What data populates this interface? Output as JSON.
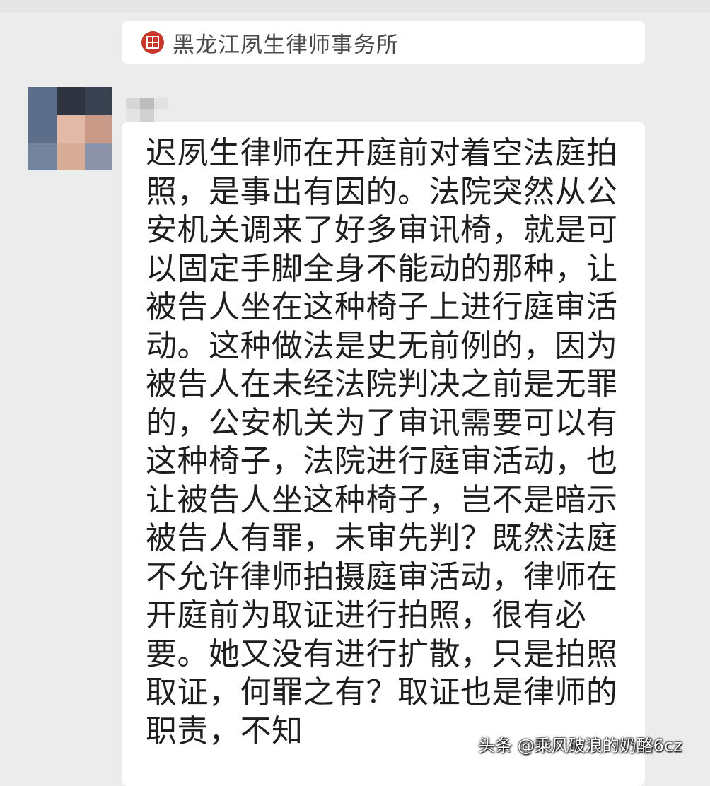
{
  "firm_card": {
    "name": "黑龙江夙生律师事务所",
    "icon": "firm-logo-icon",
    "accent_color": "#c8352b"
  },
  "sender": {
    "avatar": "blurred-avatar",
    "nickname_redacted": true
  },
  "message": {
    "text": "迟夙生律师在开庭前对着空法庭拍照，是事出有因的。法院突然从公安机关调来了好多审讯椅，就是可以固定手脚全身不能动的那种，让被告人坐在这种椅子上进行庭审活动。这种做法是史无前例的，因为被告人在未经法院判决之前是无罪的，公安机关为了审讯需要可以有这种椅子，法院进行庭审活动，也让被告人坐这种椅子，岂不是暗示被告人有罪，未审先判？既然法庭不允许律师拍摄庭审活动，律师在开庭前为取证进行拍照，很有必要。她又没有进行扩散，只是拍照取证，何罪之有？取证也是律师的职责，不知"
  },
  "watermark": {
    "text": "头条 @乘风破浪的奶酪6cz"
  }
}
